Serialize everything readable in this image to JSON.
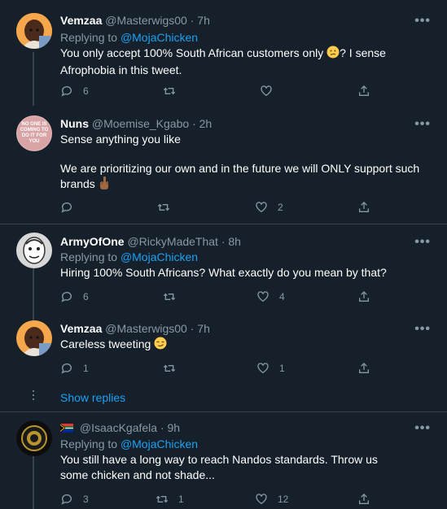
{
  "tweets": [
    {
      "name": "Vemzaa",
      "handle": "@Masterwigs00",
      "dot": "·",
      "time": "7h",
      "replying_prefix": "Replying to ",
      "replying_to": "@MojaChicken",
      "text_before_emoji": "You only accept 100% South African customers only ",
      "emoji": "confused-face",
      "text_after_emoji": "? I sense Afrophobia in this tweet.",
      "replies": "6",
      "retweets": "",
      "likes": ""
    },
    {
      "name": "Nuns",
      "handle": "@Moemise_Kgabo",
      "dot": "·",
      "time": "2h",
      "avatar_text": "NO ONE IS COMING TO DO IT FOR YOU",
      "line1": "Sense anything you like",
      "line2_before_emoji": "We are prioritizing our own and in the future we will ONLY support such brands ",
      "emoji": "middle-finger",
      "replies": "",
      "retweets": "",
      "likes": "2"
    },
    {
      "name": "ArmyOfOne",
      "handle": "@RickyMadeThat",
      "dot": "·",
      "time": "8h",
      "replying_prefix": "Replying to ",
      "replying_to": "@MojaChicken",
      "text": "Hiring 100%  South Africans? What exactly do you mean by that?",
      "replies": "6",
      "retweets": "",
      "likes": "4"
    },
    {
      "name": "Vemzaa",
      "handle": "@Masterwigs00",
      "dot": "·",
      "time": "7h",
      "text_before_emoji": "Careless tweeting ",
      "emoji": "smirking-face",
      "replies": "1",
      "retweets": "",
      "likes": "1"
    },
    {
      "name": "",
      "flag": "south-africa-flag",
      "handle": "@IsaacKgafela",
      "dot": "·",
      "time": "9h",
      "replying_prefix": "Replying to ",
      "replying_to": "@MojaChicken",
      "text": "You still have a long way to reach Nandos standards. Throw us some chicken and not shade...",
      "replies": "3",
      "retweets": "1",
      "likes": "12"
    }
  ],
  "show_replies_label": "Show replies",
  "more_glyph": "•••",
  "colors": {
    "background": "#15202b",
    "text": "#ffffff",
    "muted": "#8899a6",
    "link": "#1da1f2",
    "divider": "#38444d"
  }
}
